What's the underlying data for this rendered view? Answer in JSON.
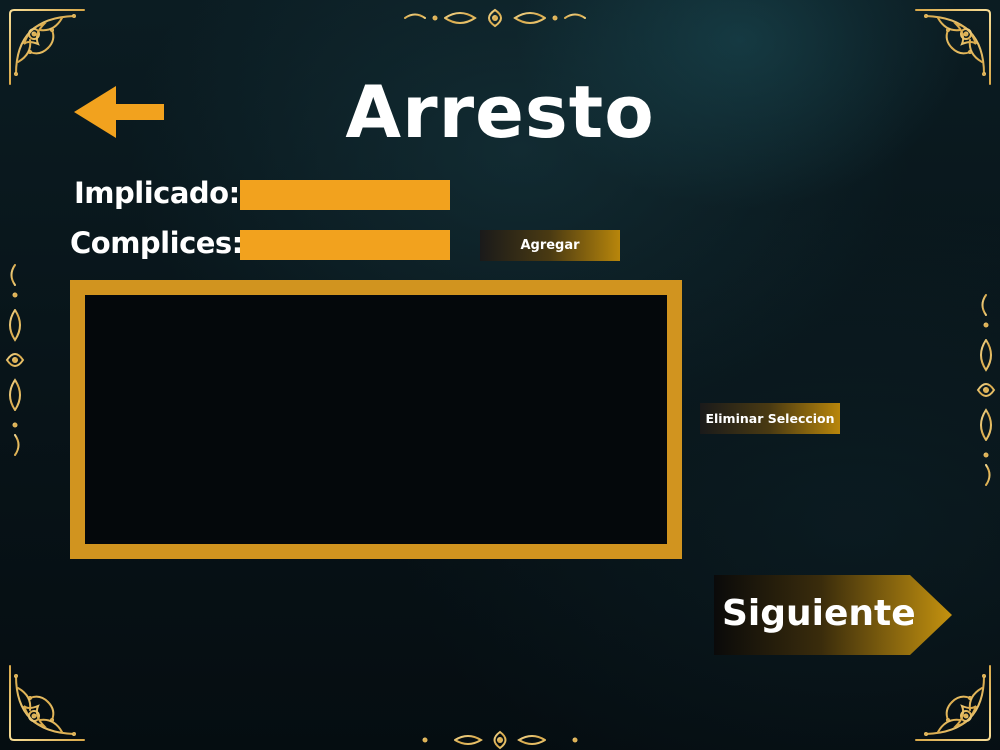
{
  "page": {
    "title": "Arresto"
  },
  "form": {
    "implicado_label": "Implicado:",
    "implicado_value": "",
    "complices_label": "Complices:",
    "complices_value": ""
  },
  "buttons": {
    "agregar_label": "Agregar",
    "eliminar_label": "Eliminar Seleccion",
    "siguiente_label": "Siguiente"
  },
  "accomplices_list": [],
  "icons": {
    "back": "arrow-left-icon",
    "ornament": "baroque-gold-flourish"
  },
  "colors": {
    "accent": "#f2a21e",
    "frame": "#d1941f",
    "ornament_gold": "#e8c270",
    "background": "#081419",
    "text": "#ffffff"
  }
}
